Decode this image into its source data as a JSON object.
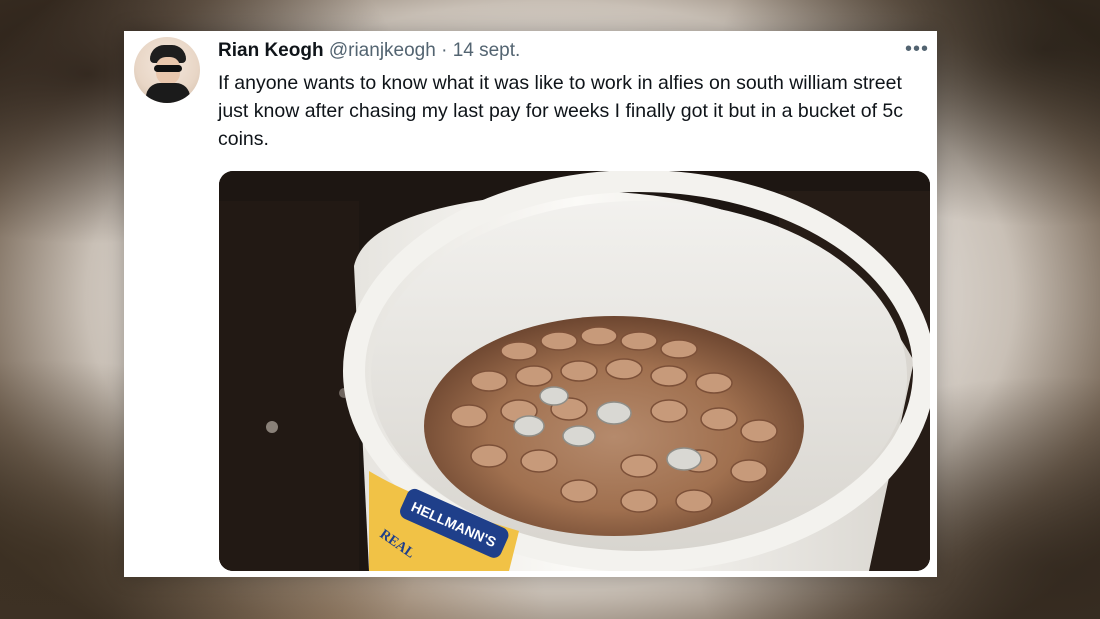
{
  "tweet": {
    "display_name": "Rian Keogh",
    "handle": "@rianjkeogh",
    "separator": "·",
    "date": "14 sept.",
    "more_icon": "more-horizontal-icon",
    "more_glyph": "•••",
    "text": "If anyone wants to know what it was like to work in alfies on south william street just know after chasing my last pay for weeks I finally got it but in a bucket of 5c coins."
  },
  "media": {
    "description_icon": "photo",
    "bucket_brand": "HELLMANN'S",
    "bucket_label_sub": "REAL"
  },
  "colors": {
    "text_primary": "#0f1419",
    "text_secondary": "#536471",
    "card_bg": "#ffffff"
  }
}
